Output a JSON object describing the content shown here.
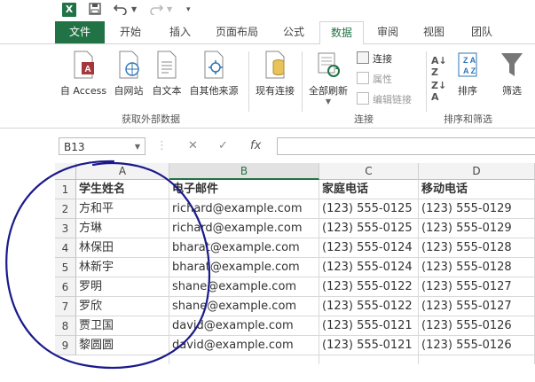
{
  "qat": {
    "app_icon": "X",
    "icons": [
      "save-icon",
      "undo-icon",
      "redo-icon"
    ]
  },
  "tabs": [
    {
      "label": "文件",
      "kind": "file"
    },
    {
      "label": "开始"
    },
    {
      "label": "插入"
    },
    {
      "label": "页面布局"
    },
    {
      "label": "公式"
    },
    {
      "label": "数据",
      "kind": "active"
    },
    {
      "label": "审阅"
    },
    {
      "label": "视图"
    },
    {
      "label": "团队"
    }
  ],
  "ribbon": {
    "from_access": "自 Access",
    "from_web": "自网站",
    "from_text": "自文本",
    "from_other": "自其他来源",
    "existing_conn": "现有连接",
    "refresh_all": "全部刷新",
    "connections": "连接",
    "properties": "属性",
    "edit_links": "编辑链接",
    "sort": "排序",
    "filter": "筛选",
    "group_external": "获取外部数据",
    "group_connections": "连接",
    "group_sort": "排序和筛选"
  },
  "formula_bar": {
    "name_box": "B13",
    "fx": "fx",
    "cancel": "✕",
    "enter": "✓",
    "value": ""
  },
  "columns": [
    "A",
    "B",
    "C",
    "D"
  ],
  "rows": [
    {
      "n": "1",
      "cells": [
        "学生姓名",
        "电子邮件",
        "家庭电话",
        "移动电话"
      ]
    },
    {
      "n": "2",
      "cells": [
        "方和平",
        "richard@example.com",
        "(123) 555-0125",
        "(123) 555-0129"
      ]
    },
    {
      "n": "3",
      "cells": [
        "方琳",
        "richard@example.com",
        "(123) 555-0125",
        "(123) 555-0129"
      ]
    },
    {
      "n": "4",
      "cells": [
        "林保田",
        "bharat@example.com",
        "(123) 555-0124",
        "(123) 555-0128"
      ]
    },
    {
      "n": "5",
      "cells": [
        "林新宇",
        "bharat@example.com",
        "(123) 555-0124",
        "(123) 555-0128"
      ]
    },
    {
      "n": "6",
      "cells": [
        "罗明",
        "shane@example.com",
        "(123) 555-0122",
        "(123) 555-0127"
      ]
    },
    {
      "n": "7",
      "cells": [
        "罗欣",
        "shane@example.com",
        "(123) 555-0122",
        "(123) 555-0127"
      ]
    },
    {
      "n": "8",
      "cells": [
        "贾卫国",
        "david@example.com",
        "(123) 555-0121",
        "(123) 555-0126"
      ]
    },
    {
      "n": "9",
      "cells": [
        "黎圆圆",
        "david@example.com",
        "(123) 555-0121",
        "(123) 555-0126"
      ]
    }
  ],
  "colors": {
    "accent": "#217346",
    "annotation": "#1a1a8c"
  }
}
